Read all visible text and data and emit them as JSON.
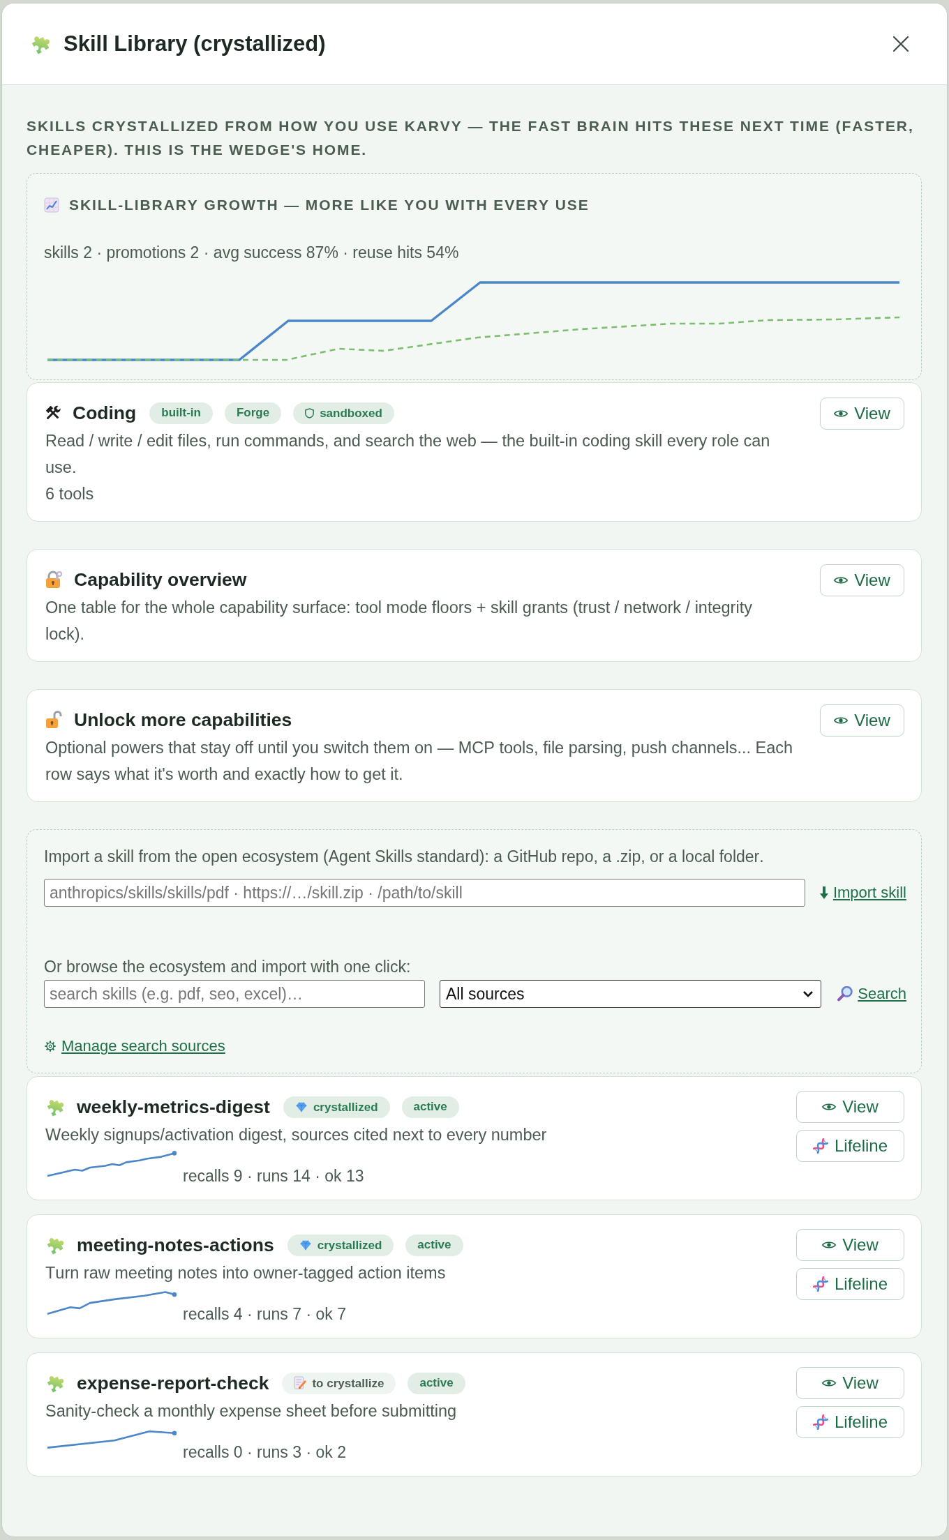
{
  "window": {
    "title": "Skill Library (crystallized)"
  },
  "intro": "SKILLS CRYSTALLIZED FROM HOW YOU USE KARVY — THE FAST BRAIN HITS THESE NEXT TIME (FASTER, CHEAPER). THIS IS THE WEDGE'S HOME.",
  "growth": {
    "title": "SKILL-LIBRARY GROWTH — MORE LIKE YOU WITH EVERY USE",
    "stats": "skills 2 · promotions 2 · avg success 87% · reuse hits 54%"
  },
  "cards": [
    {
      "kind": "builtin",
      "title": "Coding",
      "badges": [
        {
          "kind": "tag",
          "label": "built-in"
        },
        {
          "kind": "tag",
          "label": "Forge"
        },
        {
          "kind": "sandbox",
          "label": "sandboxed"
        }
      ],
      "description": "Read / write / edit files, run commands, and search the web — the built-in coding skill every role can use.",
      "meta": "6 tools",
      "button": "View"
    },
    {
      "kind": "overview",
      "title": "Capability overview",
      "description": "One table for the whole capability surface: tool mode floors + skill grants (trust / network / integrity lock).",
      "button": "View"
    },
    {
      "kind": "unlock",
      "title": "Unlock more capabilities",
      "description": "Optional powers that stay off until you switch them on — MCP tools, file parsing, push channels... Each row says what it's worth and exactly how to get it.",
      "button": "View"
    }
  ],
  "import": {
    "intro": "Import a skill from the open ecosystem (Agent Skills standard): a GitHub repo, a .zip, or a local folder.",
    "source_field": {
      "placeholder": "anthropics/skills/skills/pdf · https://…/skill.zip · /path/to/skill"
    },
    "import_link": "Import skill",
    "browse_label": "Or browse the ecosystem and import with one click:",
    "search_field": {
      "placeholder": "search skills (e.g. pdf, seo, excel)…"
    },
    "source_select": {
      "value": "All sources"
    },
    "search_link": "Search",
    "manage_link": "Manage search sources"
  },
  "skills": [
    {
      "name": "weekly-metrics-digest",
      "stage": {
        "label": "crystallized",
        "crystallized": true
      },
      "status": "active",
      "description": "Weekly signups/activation digest, sources cited next to every number",
      "stats": "recalls 9 · runs 14 · ok 13",
      "buttons": [
        {
          "kind": "view",
          "label": "View"
        },
        {
          "kind": "lifeline",
          "label": "Lifeline"
        }
      ]
    },
    {
      "name": "meeting-notes-actions",
      "stage": {
        "label": "crystallized",
        "crystallized": true
      },
      "status": "active",
      "description": "Turn raw meeting notes into owner-tagged action items",
      "stats": "recalls 4 · runs 7 · ok 7",
      "buttons": [
        {
          "kind": "view",
          "label": "View"
        },
        {
          "kind": "lifeline",
          "label": "Lifeline"
        }
      ]
    },
    {
      "name": "expense-report-check",
      "stage": {
        "label": "to crystallize",
        "crystallized": false
      },
      "status": "active",
      "description": "Sanity-check a monthly expense sheet before submitting",
      "stats": "recalls 0 · runs 3 · ok 2",
      "buttons": [
        {
          "kind": "view",
          "label": "View"
        },
        {
          "kind": "lifeline",
          "label": "Lifeline"
        }
      ]
    }
  ]
}
